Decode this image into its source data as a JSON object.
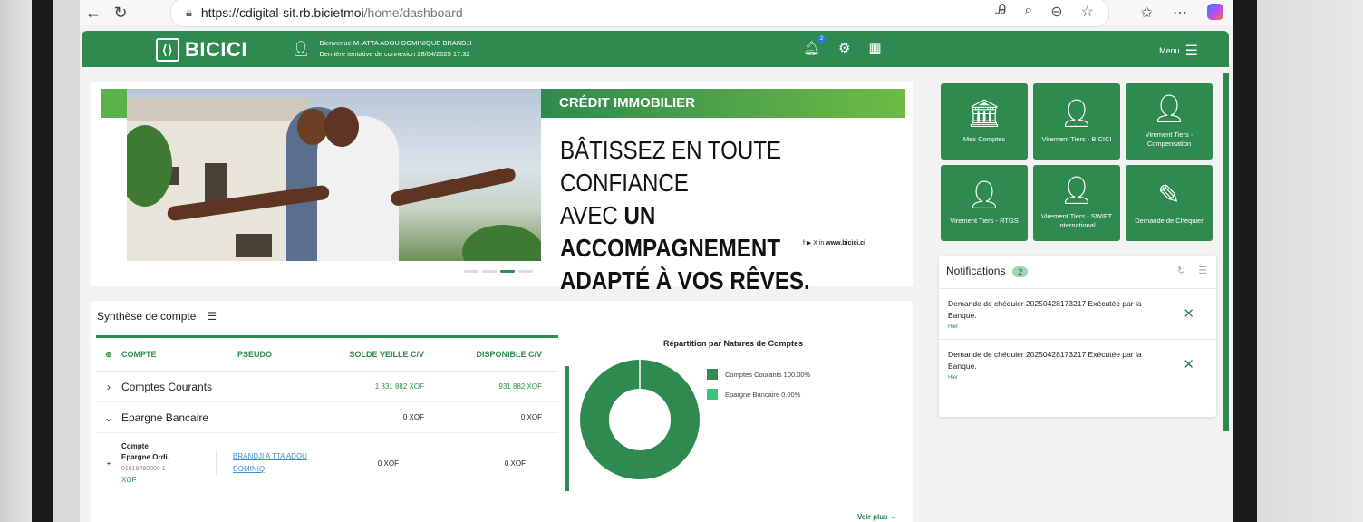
{
  "browser": {
    "url_host": "https://cdigital-sit.rb.bicietmoi",
    "url_path": "/home/dashboard",
    "icons": [
      "back-icon",
      "reload-icon",
      "lock-icon",
      "read-aloud-icon",
      "zoom-icon",
      "minus-circle-icon",
      "star-icon",
      "favorites-icon",
      "more-icon",
      "copilot-icon"
    ]
  },
  "header": {
    "brand": "BICICI",
    "welcome": "Bienvenue M. ATTA ADOU DOMINIQUE BRANDJI",
    "last_login": "Dernière tentative de connexion 28/04/2025 17:32",
    "notif_badge": "2",
    "menu_label": "Menu",
    "accent": "#2f8a4f"
  },
  "banner": {
    "tag": "CRÉDIT IMMOBILIER",
    "line1": "BÂTISSEZ EN TOUTE CONFIANCE",
    "line2_plain": "AVEC ",
    "line2_bold": "UN ACCOMPAGNEMENT",
    "line3_bold": "ADAPTÉ À VOS RÊVES.",
    "site": "www.bicici.ci"
  },
  "tiles": [
    {
      "label": "Mes Comptes",
      "icon": "bank-icon"
    },
    {
      "label": "Virement Tiers - BICICI",
      "icon": "transfer-icon"
    },
    {
      "label": "Virement Tiers - Compensation",
      "icon": "transfer-icon"
    },
    {
      "label": "Virement Tiers - RTGS",
      "icon": "transfer-icon"
    },
    {
      "label": "Virement Tiers - SWIFT International",
      "icon": "transfer-icon"
    },
    {
      "label": "Demande de Chéquier",
      "icon": "cheque-icon"
    }
  ],
  "notifications": {
    "title": "Notifications",
    "count": "2",
    "items": [
      {
        "message": "Demande de chéquier 20250428173217 Exécutée par la Banque.",
        "time": "Hier"
      },
      {
        "message": "Demande de chéquier 20250428173217 Exécutée par la Banque.",
        "time": "Hier"
      }
    ]
  },
  "synthese": {
    "title": "Synthèse de compte",
    "columns": [
      "COMPTE",
      "PSEUDO",
      "SOLDE VEILLE C/V",
      "DISPONIBLE C/V"
    ],
    "rows": [
      {
        "name": "Comptes Courants",
        "solde": "1 831 882 XOF",
        "disponible": "931 882 XOF"
      },
      {
        "name": "Epargne Bancaire",
        "solde": "0 XOF",
        "disponible": "0 XOF"
      }
    ],
    "sub": {
      "name1": "Compte",
      "name2": "Epargne Ordi.",
      "number": "01019490000 1",
      "currency": "XOF",
      "pseudo": "BRANDJI A TTA ADOU DOMINIQ",
      "solde": "0 XOF",
      "disponible": "0 XOF"
    },
    "voir_plus": "Voir plus →"
  },
  "chart_data": {
    "type": "pie",
    "title": "Répartition par Natures de Comptes",
    "categories": [
      "Comptes Courants",
      "Epargne Bancaire"
    ],
    "values": [
      100,
      0
    ],
    "legend_labels": [
      "Comptes Courants 100.00%",
      "Epargne Bancaire 0.00%"
    ],
    "colors": [
      "#2f8a4f",
      "#3dbf7e"
    ],
    "donut": true
  }
}
